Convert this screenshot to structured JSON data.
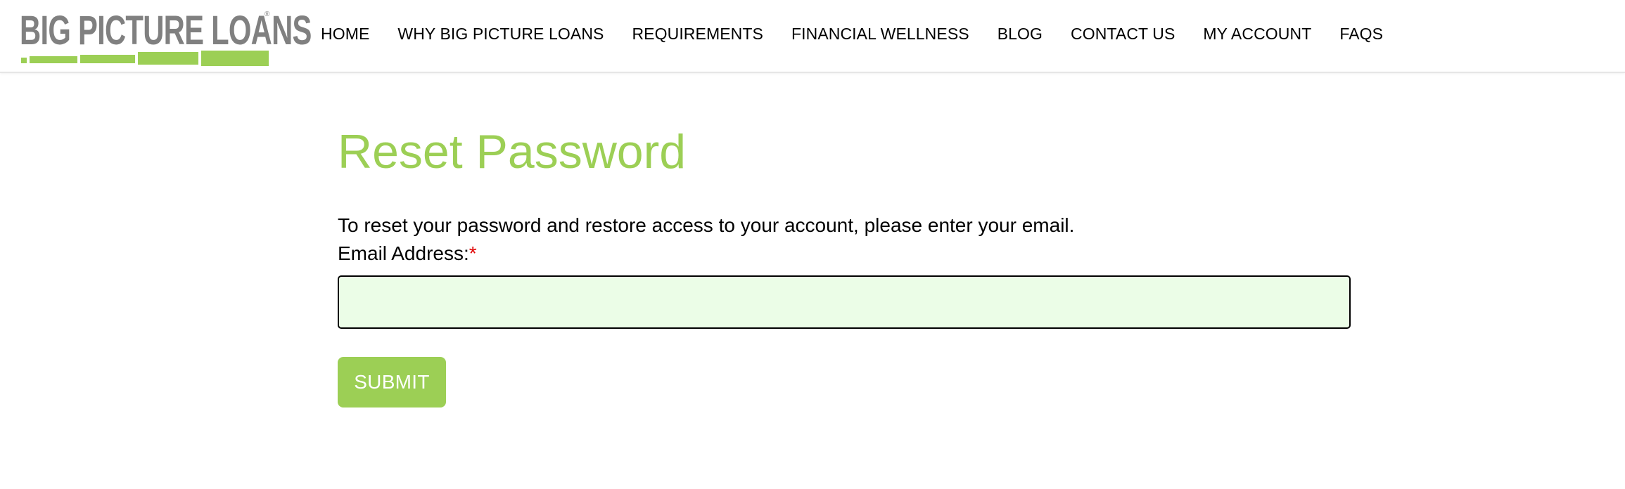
{
  "brand": {
    "name": "BIG PICTURE LOANS",
    "registered_mark": "®",
    "primary_color": "#9ccf55",
    "gray_color": "#808080"
  },
  "nav": {
    "items": [
      {
        "label": "HOME"
      },
      {
        "label": "WHY BIG PICTURE LOANS"
      },
      {
        "label": "REQUIREMENTS"
      },
      {
        "label": "FINANCIAL WELLNESS"
      },
      {
        "label": "BLOG"
      },
      {
        "label": "CONTACT US"
      },
      {
        "label": "MY ACCOUNT"
      },
      {
        "label": "FAQS"
      }
    ]
  },
  "reset_form": {
    "title": "Reset Password",
    "intro": "To reset your password and restore access to your account, please enter your email.",
    "email_label": "Email Address:",
    "required_mark": "*",
    "email_value": "",
    "submit_label": "SUBMIT",
    "input_background": "#ebfde7"
  }
}
